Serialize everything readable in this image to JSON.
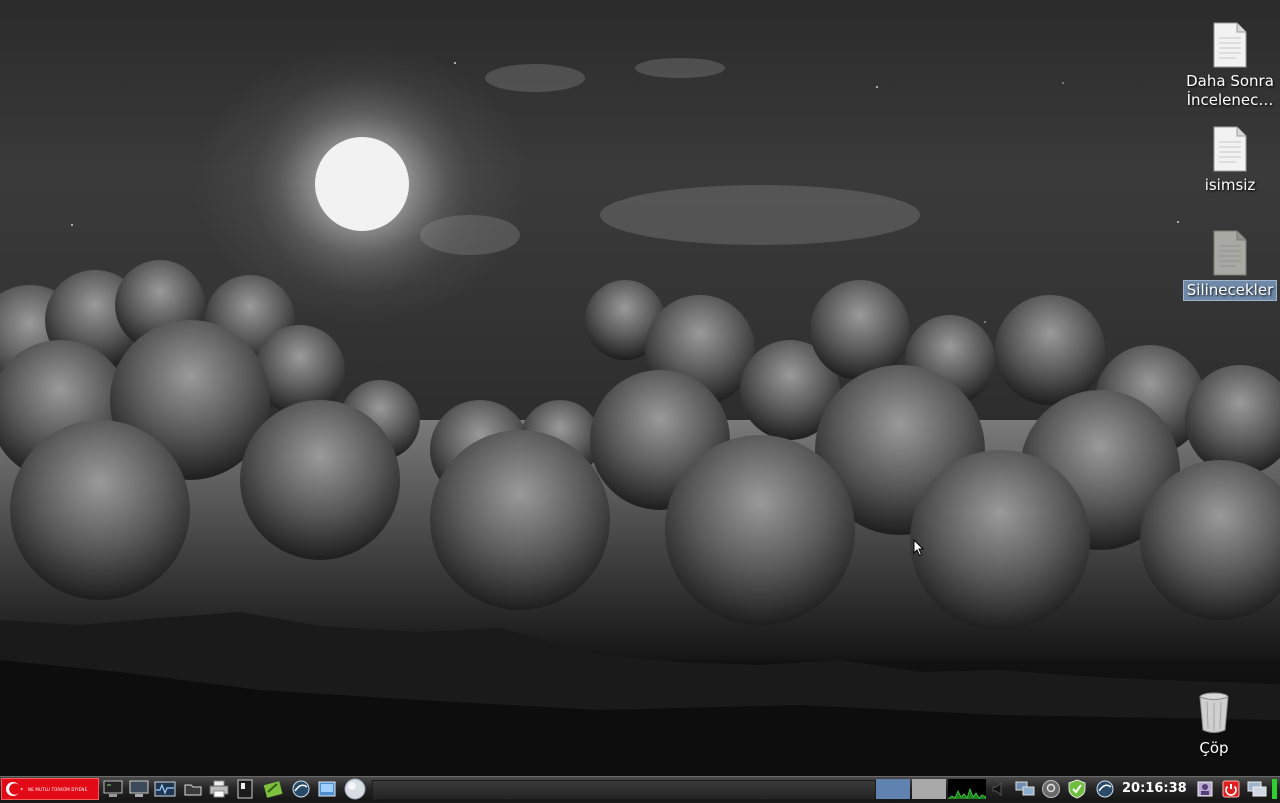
{
  "desktop": {
    "icons": [
      {
        "label_line1": "Daha Sonra",
        "label_line2": "İncelenec…"
      },
      {
        "label": "isimsiz"
      },
      {
        "label": "Silinecekler"
      },
      {
        "label": "Çöp"
      }
    ]
  },
  "taskbar": {
    "start_slogan": "NE MUTLU TÜRKÜM DİYENE",
    "clock": "20:16:38",
    "launchers": [
      "terminal-icon",
      "monitor-icon",
      "system-monitor-icon",
      "file-manager-icon",
      "printer-icon",
      "text-editor-icon",
      "graphics-icon",
      "network-globe-icon",
      "image-viewer-icon",
      "web-browser-icon"
    ],
    "tray": [
      "volume-icon",
      "network-icon",
      "password-icon",
      "security-shield-icon",
      "update-icon",
      "user-icon",
      "power-icon",
      "show-desktop-icon"
    ]
  },
  "colors": {
    "start_red": "#e30a17",
    "workspace_active": "#5f82b0",
    "selection": "#6f89a8"
  }
}
